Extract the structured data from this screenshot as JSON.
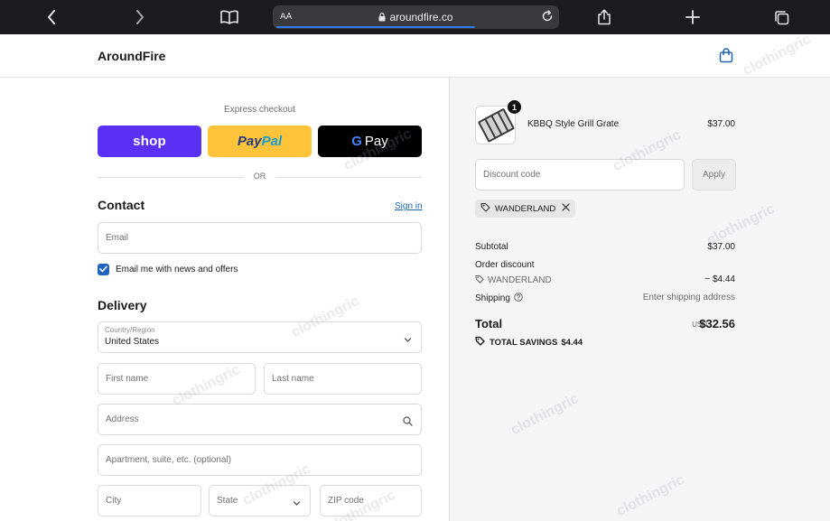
{
  "browser": {
    "url_host": "aroundfire.co",
    "text_size_label": "AA",
    "icons": [
      "back-icon",
      "forward-icon",
      "bookmarks-icon",
      "lock-icon",
      "reload-icon",
      "share-icon",
      "new-tab-icon",
      "tabs-icon"
    ]
  },
  "header": {
    "brand": "AroundFire",
    "cart_icon": "shopping-bag-icon"
  },
  "express": {
    "label": "Express checkout",
    "shop_label": "shop",
    "paypal_part1": "Pay",
    "paypal_part2": "Pal",
    "gpay_g": "G",
    "gpay_label": "Pay",
    "or_label": "OR"
  },
  "contact": {
    "title": "Contact",
    "sign_in": "Sign in",
    "email_placeholder": "Email",
    "newsletter_checked": true,
    "newsletter_label": "Email me with news and offers"
  },
  "delivery": {
    "title": "Delivery",
    "country_label": "Country/Region",
    "country_value": "United States",
    "first_name_placeholder": "First name",
    "last_name_placeholder": "Last name",
    "address_placeholder": "Address",
    "apartment_placeholder": "Apartment, suite, etc. (optional)",
    "city_placeholder": "City",
    "state_placeholder": "State",
    "zip_placeholder": "ZIP code"
  },
  "summary": {
    "item": {
      "name": "KBBQ Style Grill Grate",
      "price": "$37.00",
      "quantity": "1"
    },
    "discount_placeholder": "Discount code",
    "apply_label": "Apply",
    "applied_code": "WANDERLAND",
    "subtotal_label": "Subtotal",
    "subtotal_value": "$37.00",
    "order_discount_label": "Order discount",
    "order_discount_code": "WANDERLAND",
    "order_discount_value": "− $4.44",
    "shipping_label": "Shipping",
    "shipping_value": "Enter shipping address",
    "total_label": "Total",
    "total_currency": "USD",
    "total_value": "$32.56",
    "total_savings_label": "TOTAL SAVINGS",
    "total_savings_value": "$4.44"
  },
  "watermark": "clothingric",
  "colors": {
    "shop_purple": "#5a31f4",
    "paypal_yellow": "#ffc439",
    "link_blue": "#1d64b0",
    "checkbox_blue": "#1f64c0"
  }
}
